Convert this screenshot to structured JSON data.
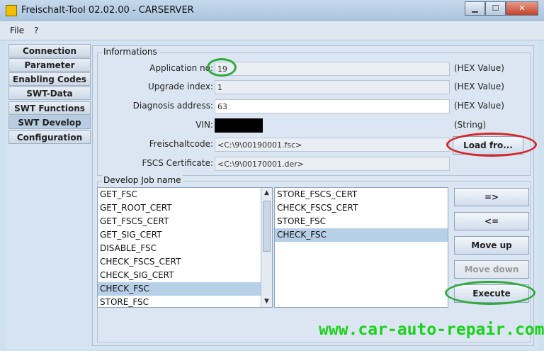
{
  "window": {
    "title": "Freischalt-Tool 02.02.00 - CARSERVER",
    "min": "▁",
    "max": "☐",
    "close": "✕"
  },
  "menu": {
    "file": "File",
    "help": "?"
  },
  "tabs": [
    "Connection",
    "Parameter",
    "Enabling Codes",
    "SWT-Data",
    "SWT Functions",
    "SWT Develop",
    "Configuration"
  ],
  "active_tab": "SWT Develop",
  "informations": {
    "title": "Informations",
    "application_no": {
      "label": "Application no:",
      "value": "19",
      "unit": "(HEX Value)"
    },
    "upgrade_index": {
      "label": "Upgrade index:",
      "value": "1",
      "unit": "(HEX Value)"
    },
    "diagnosis_address": {
      "label": "Diagnosis address:",
      "value": "63",
      "unit": "(HEX Value)"
    },
    "vin": {
      "label": "VIN:",
      "value": "",
      "unit": "(String)"
    },
    "freischaltcode": {
      "label": "Freischaltcode:",
      "value": "<C:\\9\\00190001.fsc>"
    },
    "fscs_certificate": {
      "label": "FSCS Certificate:",
      "value": "<C:\\9\\00170001.der>"
    },
    "load_button": "Load fro..."
  },
  "develop": {
    "title": "Develop Job name",
    "left_list": [
      "GET_FSC",
      "GET_ROOT_CERT",
      "GET_FSCS_CERT",
      "GET_SIG_CERT",
      "DISABLE_FSC",
      "CHECK_FSCS_CERT",
      "CHECK_SIG_CERT",
      "CHECK_FSC",
      "STORE_FSC"
    ],
    "left_selected": "CHECK_FSC",
    "right_list": [
      "STORE_FSCS_CERT",
      "CHECK_FSCS_CERT",
      "STORE_FSC",
      "CHECK_FSC"
    ],
    "right_selected": "CHECK_FSC",
    "buttons": {
      "add": "=>",
      "remove": "<=",
      "move_up": "Move up",
      "move_down": "Move down",
      "execute": "Execute"
    }
  },
  "watermark": "www.car-auto-repair.com",
  "colors": {
    "highlight_green": "#2faa3a",
    "highlight_red": "#d6262a",
    "watermark": "#19d219",
    "selection": "#b8cfe8"
  }
}
